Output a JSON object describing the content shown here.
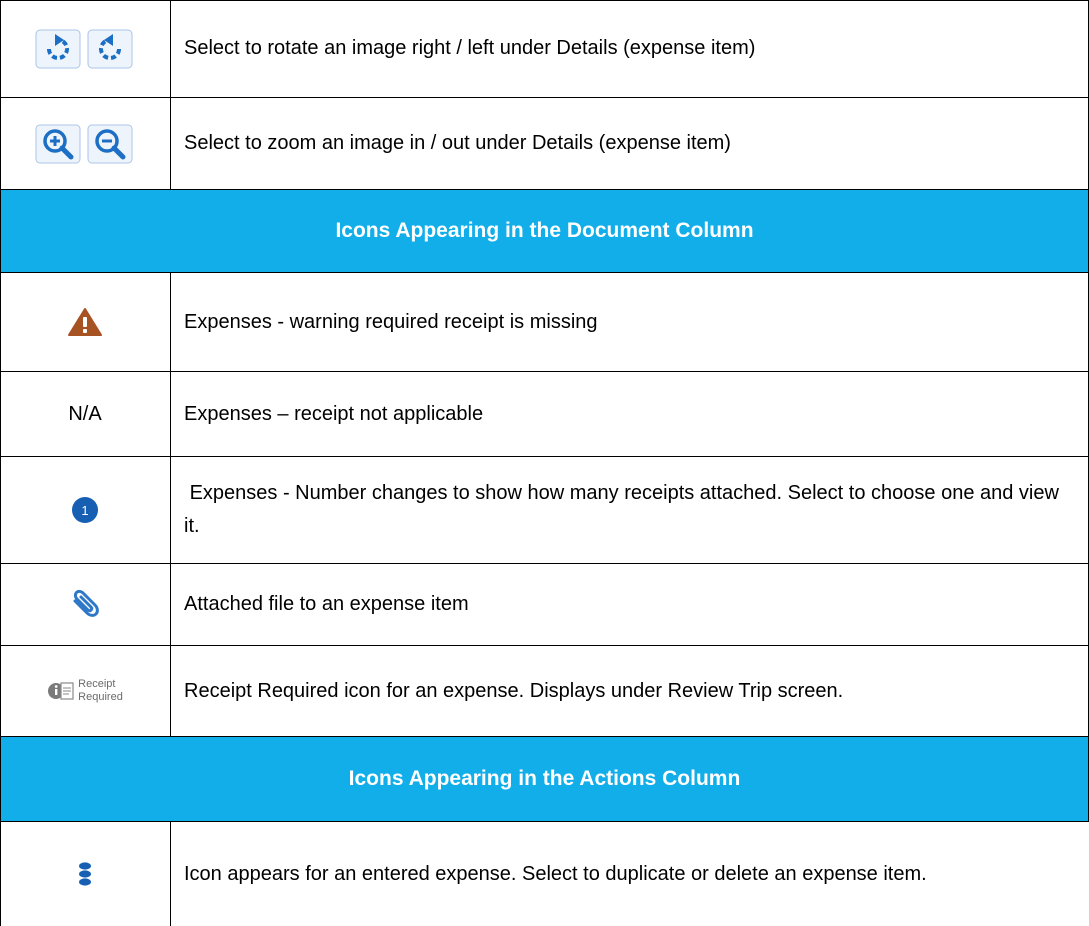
{
  "rows": {
    "rotate": {
      "icon": "rotate-right-left-icons",
      "description": "Select to rotate an image right / left under Details (expense item)"
    },
    "zoom": {
      "icon": "zoom-in-out-icons",
      "description": "Select to zoom an image in / out under Details (expense item)"
    },
    "document_header": "Icons Appearing in the Document Column",
    "warning": {
      "icon": "warning-triangle-icon",
      "description": "Expenses - warning required receipt is missing"
    },
    "na": {
      "icon_text": "N/A",
      "description": "Expenses – receipt not applicable"
    },
    "receipt_count": {
      "icon": "receipt-count-badge-icon",
      "badge_number": "1",
      "description": " Expenses - Number changes to show how many receipts attached. Select to choose one and view it."
    },
    "attached": {
      "icon": "paperclip-icon",
      "description": "Attached file to an expense item"
    },
    "receipt_required": {
      "icon": "receipt-required-icon",
      "label_line1": "Receipt",
      "label_line2": "Required",
      "description": "Receipt Required icon for an expense. Displays under Review Trip screen."
    },
    "actions_header": "Icons Appearing in the Actions Column",
    "more_actions": {
      "icon": "vertical-ellipsis-icon",
      "description": "Icon appears for an entered expense. Select to duplicate or delete an expense item."
    }
  },
  "colors": {
    "header_bg": "#12aee9",
    "header_text": "#ffffff",
    "icon_blue": "#1c6fc4",
    "warning_brown": "#a65222",
    "badge_blue": "#175fb2"
  }
}
